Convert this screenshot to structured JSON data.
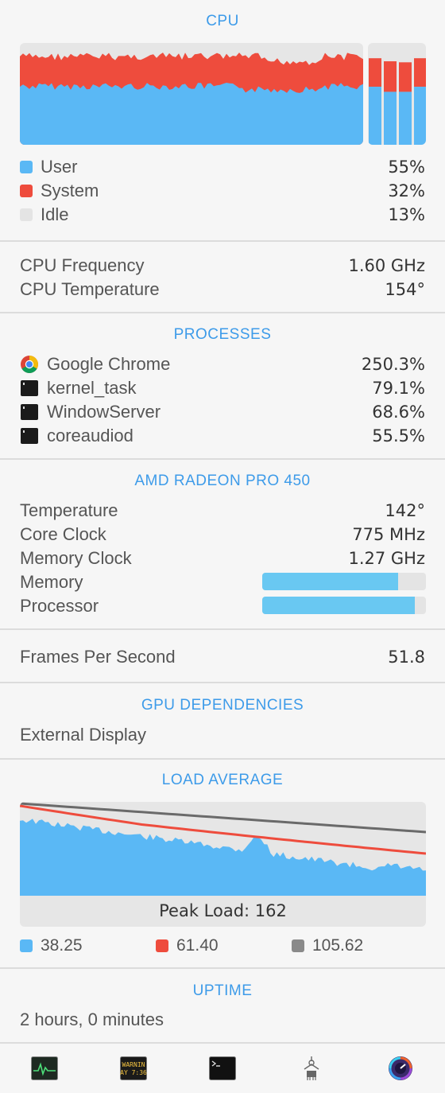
{
  "cpu": {
    "title": "CPU",
    "legend": [
      {
        "label": "User",
        "value": "55%",
        "color": "#5ab8f5"
      },
      {
        "label": "System",
        "value": "32%",
        "color": "#ee4c3d"
      },
      {
        "label": "Idle",
        "value": "13%",
        "color": "#e4e4e4"
      }
    ],
    "cores_percent": [
      {
        "user": 57,
        "system": 28
      },
      {
        "user": 52,
        "system": 30
      },
      {
        "user": 52,
        "system": 29
      },
      {
        "user": 57,
        "system": 28
      }
    ],
    "frequency_label": "CPU Frequency",
    "frequency_value": "1.60 GHz",
    "temperature_label": "CPU Temperature",
    "temperature_value": "154°"
  },
  "processes": {
    "title": "PROCESSES",
    "items": [
      {
        "name": "Google Chrome",
        "value": "250.3%",
        "icon": "chrome-icon"
      },
      {
        "name": "kernel_task",
        "value": "79.1%",
        "icon": "terminal-icon"
      },
      {
        "name": "WindowServer",
        "value": "68.6%",
        "icon": "terminal-icon"
      },
      {
        "name": "coreaudiod",
        "value": "55.5%",
        "icon": "terminal-icon"
      }
    ]
  },
  "gpu": {
    "title": "AMD RADEON PRO 450",
    "temperature_label": "Temperature",
    "temperature_value": "142°",
    "core_clock_label": "Core Clock",
    "core_clock_value": "775 MHz",
    "memory_clock_label": "Memory Clock",
    "memory_clock_value": "1.27 GHz",
    "memory_label": "Memory",
    "memory_fraction": 0.83,
    "processor_label": "Processor",
    "processor_fraction": 0.93
  },
  "fps": {
    "label": "Frames Per Second",
    "value": "51.8"
  },
  "gpu_dependencies": {
    "title": "GPU DEPENDENCIES",
    "item": "External Display"
  },
  "load_average": {
    "title": "LOAD AVERAGE",
    "peak_label": "Peak Load: 162",
    "legend": [
      {
        "value": "38.25",
        "color": "#5ab8f5"
      },
      {
        "value": "61.40",
        "color": "#ee4c3d"
      },
      {
        "value": "105.62",
        "color": "#8a8a8a"
      }
    ]
  },
  "uptime": {
    "title": "UPTIME",
    "value": "2 hours, 0 minutes"
  },
  "dock": [
    {
      "icon": "activity-monitor-icon"
    },
    {
      "icon": "console-icon",
      "text_top": "WARNIN",
      "text_bottom": "AY 7:36"
    },
    {
      "icon": "terminal-icon"
    },
    {
      "icon": "system-information-icon"
    },
    {
      "icon": "istat-menus-icon"
    }
  ]
}
